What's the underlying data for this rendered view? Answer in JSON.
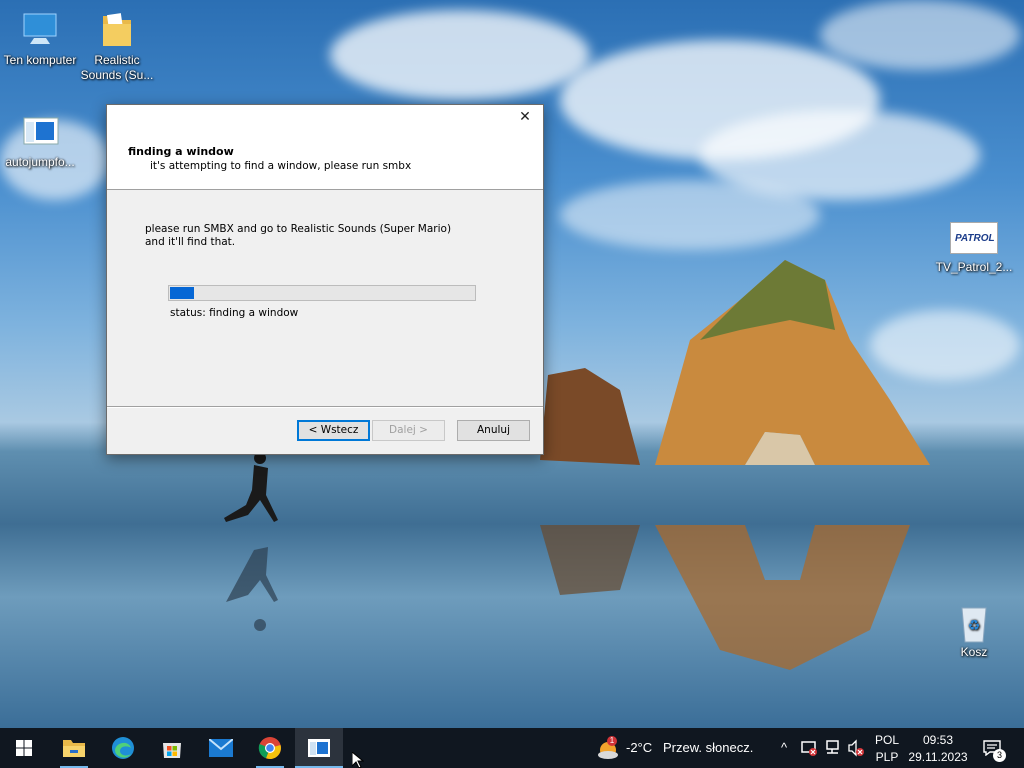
{
  "desktop": {
    "icons": [
      {
        "label": "Ten komputer"
      },
      {
        "label": "Realistic Sounds (Su..."
      },
      {
        "label": "autojumpfo..."
      },
      {
        "label": "TV_Patrol_2..."
      },
      {
        "label": "Kosz"
      }
    ],
    "patrol_logo_text": "PATROL"
  },
  "dialog": {
    "close_glyph": "✕",
    "header": {
      "title": "finding a window",
      "subtitle": "it's attempting to find a window, please run smbx"
    },
    "body_text": "please run SMBX and go to Realistic Sounds (Super Mario)\nand it'll find that.",
    "progress_fraction": 0.08,
    "status": "status: finding a window",
    "buttons": {
      "back": "< Wstecz",
      "next": "Dalej >",
      "cancel": "Anuluj"
    }
  },
  "taskbar": {
    "apps": [
      {
        "name": "file-explorer-icon"
      },
      {
        "name": "edge-icon"
      },
      {
        "name": "store-icon"
      },
      {
        "name": "mail-icon"
      },
      {
        "name": "chrome-icon"
      },
      {
        "name": "installer-app-icon"
      }
    ],
    "weather": {
      "temp": "-2°C",
      "desc": "Przew. słonecz.",
      "badge": "1"
    },
    "lang_top": "POL",
    "lang_bottom": "PLP",
    "time": "09:53",
    "date": "29.11.2023",
    "notification_count": "3",
    "colors": {
      "accent": "#0078d7",
      "progress": "#0667d5"
    }
  }
}
